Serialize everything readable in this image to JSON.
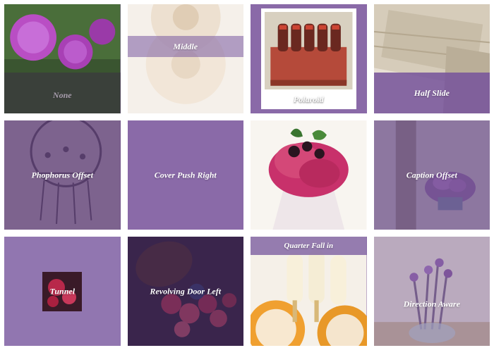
{
  "row1": {
    "none": "None",
    "middle": "Middle",
    "polaroid": "Polaroid",
    "halfslide": "Half Slide"
  },
  "row2": {
    "phophorus": "Phophorus Offset",
    "coverpush": "Cover Push Right",
    "captionoffset": "Caption Offset"
  },
  "row3": {
    "tunnel": "Tunnel",
    "revolving": "Revolving Door Left",
    "quarterfall": "Quarter Fall in",
    "direction": "Direction Aware"
  }
}
